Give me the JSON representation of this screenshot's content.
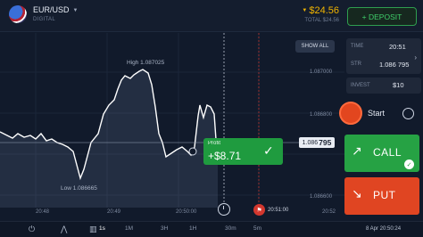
{
  "header": {
    "asset_name": "EUR/USD",
    "asset_type": "DIGITAL",
    "balance": "$24.56",
    "balance_total": "TOTAL $24.56",
    "deposit_label": "+ DEPOSIT"
  },
  "chart": {
    "show_all_label": "SHOW ALL",
    "high_label": "High 1.087025",
    "low_label": "Low 1.086665",
    "price_ticks": [
      "1.087000",
      "1.086800",
      "1.086600"
    ],
    "current_price_prefix": "1.086",
    "current_price_suffix": "795",
    "time_ticks": [
      "20:48",
      "20:49",
      "20:50:00",
      "20:51:00",
      "20:52"
    ],
    "profit_title": "Profit",
    "profit_value": "+$8.71",
    "series": [
      [
        0,
        148
      ],
      [
        8,
        152
      ],
      [
        14,
        155
      ],
      [
        20,
        150
      ],
      [
        27,
        154
      ],
      [
        34,
        152
      ],
      [
        40,
        156
      ],
      [
        46,
        150
      ],
      [
        52,
        158
      ],
      [
        58,
        156
      ],
      [
        64,
        160
      ],
      [
        70,
        162
      ],
      [
        76,
        165
      ],
      [
        82,
        170
      ],
      [
        86,
        185
      ],
      [
        90,
        200
      ],
      [
        94,
        190
      ],
      [
        98,
        175
      ],
      [
        102,
        160
      ],
      [
        106,
        155
      ],
      [
        110,
        150
      ],
      [
        116,
        128
      ],
      [
        122,
        118
      ],
      [
        128,
        112
      ],
      [
        132,
        100
      ],
      [
        136,
        90
      ],
      [
        140,
        85
      ],
      [
        146,
        88
      ],
      [
        150,
        84
      ],
      [
        156,
        80
      ],
      [
        160,
        78
      ],
      [
        166,
        82
      ],
      [
        170,
        95
      ],
      [
        174,
        120
      ],
      [
        178,
        150
      ],
      [
        182,
        160
      ],
      [
        186,
        176
      ],
      [
        192,
        172
      ],
      [
        198,
        168
      ],
      [
        204,
        165
      ],
      [
        210,
        170
      ],
      [
        214,
        174
      ],
      [
        218,
        165
      ],
      [
        222,
        130
      ],
      [
        224,
        118
      ],
      [
        228,
        132
      ],
      [
        232,
        118
      ],
      [
        236,
        120
      ],
      [
        240,
        128
      ],
      [
        244,
        185
      ]
    ]
  },
  "right_panel": {
    "time_label": "TIME",
    "time_value": "20:51",
    "strike_label": "STR",
    "strike_value": "1.086 795",
    "invest_label": "INVEST",
    "invest_value": "$10",
    "start_label": "Start",
    "call_label": "CALL",
    "put_label": "PUT"
  },
  "bottom_bar": {
    "intervals": [
      "1s",
      "1M",
      "3H",
      "1H",
      "30m",
      "5m"
    ],
    "datetime": "8 Apr 20:50:24"
  },
  "colors": {
    "background": "#111a2b",
    "accent_green": "#26a244",
    "accent_red": "#e04522",
    "balance_gold": "#f0b400"
  }
}
